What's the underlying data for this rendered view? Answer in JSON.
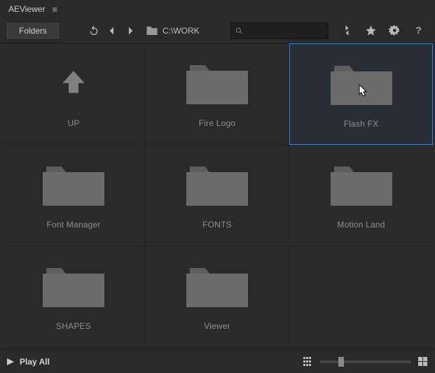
{
  "app": {
    "title": "AEViewer"
  },
  "toolbar": {
    "folders_label": "Folders",
    "path": "C:\\WORK"
  },
  "search": {
    "placeholder": "",
    "value": ""
  },
  "grid": {
    "items": [
      {
        "label": "UP",
        "type": "up"
      },
      {
        "label": "Fire Logo",
        "type": "folder"
      },
      {
        "label": "Flash FX",
        "type": "folder",
        "selected": true
      },
      {
        "label": "Font Manager",
        "type": "folder"
      },
      {
        "label": "FONTS",
        "type": "folder"
      },
      {
        "label": "Motion Land",
        "type": "folder"
      },
      {
        "label": "SHAPES",
        "type": "folder"
      },
      {
        "label": "Viewer",
        "type": "folder"
      },
      {
        "label": "",
        "type": "empty"
      }
    ]
  },
  "footer": {
    "play_all_label": "Play All",
    "slider_value": 20
  }
}
